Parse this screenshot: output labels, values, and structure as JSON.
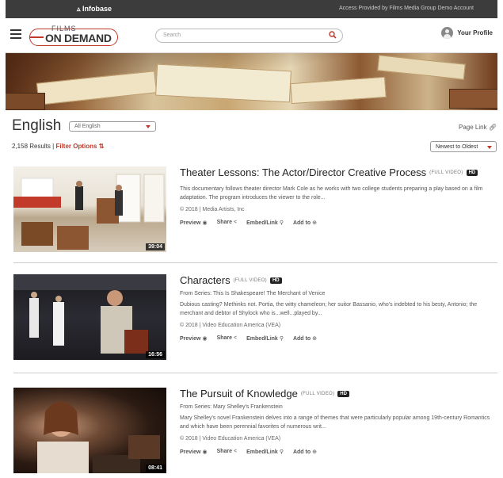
{
  "topbar": {
    "brand": "Infobase",
    "access_text": "Access Provided by Films Media Group Demo Account"
  },
  "header": {
    "logo_small": "FILMS",
    "logo_main": "ON DEMAND",
    "search_placeholder": "Search",
    "profile_label": "Your Profile"
  },
  "page": {
    "title": "English",
    "lang_select": "All English",
    "page_link": "Page Link",
    "results_count": "2,158 Results",
    "separator": "|",
    "filter_label": "Filter Options",
    "sort_label": "Newest to Oldest"
  },
  "icons": {
    "menu": "hamburger-icon",
    "search": "search-icon",
    "profile": "user-icon",
    "link": "link-icon",
    "filter": "filter-icon",
    "preview": "eye-icon",
    "share": "share-icon",
    "add": "plus-circle-icon"
  },
  "colors": {
    "accent": "#c0392b",
    "topbar": "#3c3c3c"
  },
  "actions": {
    "preview": "Preview",
    "share": "Share",
    "embed": "Embed/Link",
    "add": "Add to"
  },
  "results": [
    {
      "title": "Theater Lessons: The Actor/Director Creative Process",
      "tag": "(FULL VIDEO)",
      "hd": "HD",
      "series": "",
      "description": "This documentary follows theater director Mark Cole as he works with two college students preparing a play based on a film adaptation. The program introduces the viewer to the role...",
      "meta": "© 2018 | Media Artists, Inc",
      "duration": "39:04"
    },
    {
      "title": "Characters",
      "tag": "(FULL VIDEO)",
      "hd": "HD",
      "series": "From Series: This Is Shakespeare! The Merchant of Venice",
      "description": "Dubious casting? Methinks not. Portia, the witty chameleon; her suitor Bassanio, who's indebted to his besty, Antonio; the merchant and debtor of Shylock who is...well...played by...",
      "meta": "© 2018 | Video Education America (VEA)",
      "duration": "16:56"
    },
    {
      "title": "The Pursuit of Knowledge",
      "tag": "(FULL VIDEO)",
      "hd": "HD",
      "series": "From Series: Mary Shelley's Frankenstein",
      "description": "Mary Shelley's novel Frankenstein delves into a range of themes that were particularly popular among 19th-century Romantics and which have been perennial favorites of numerous writ...",
      "meta": "© 2018 | Video Education America (VEA)",
      "duration": "08:41"
    }
  ]
}
